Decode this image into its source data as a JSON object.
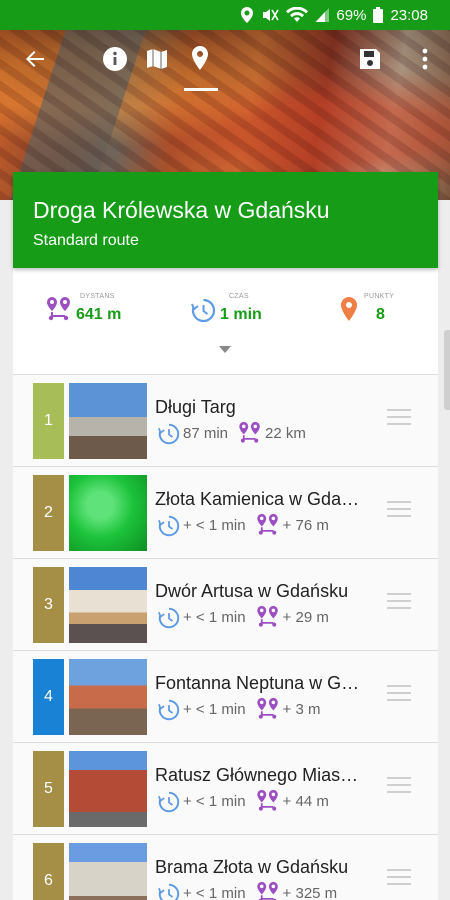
{
  "status_bar": {
    "battery": "69%",
    "time": "23:08"
  },
  "route": {
    "title": "Droga Królewska w Gdańsku",
    "subtitle": "Standard route"
  },
  "stats": {
    "distance": {
      "label": "DYSTANS",
      "value": "641 m"
    },
    "time": {
      "label": "CZAS",
      "value": "1 min"
    },
    "points": {
      "label": "PUNKTY",
      "value": "8"
    }
  },
  "colors": {
    "brand_green": "#169c17",
    "olive": "#a58f47",
    "lime": "#a7be58",
    "blue": "#1a82d5",
    "time_icon": "#5d9ae6",
    "distance_icon": "#9b4fc3",
    "pin_icon": "#f07f45"
  },
  "stops": [
    {
      "number": "1",
      "name": "Długi Targ",
      "time": "87 min",
      "distance": "22 km",
      "color": "#a7be58"
    },
    {
      "number": "2",
      "name": "Złota Kamienica w Gda…",
      "time": "+ < 1 min",
      "distance": "+ 76 m",
      "color": "#a58f47"
    },
    {
      "number": "3",
      "name": "Dwór Artusa w Gdańsku",
      "time": "+ < 1 min",
      "distance": "+ 29 m",
      "color": "#a58f47"
    },
    {
      "number": "4",
      "name": "Fontanna Neptuna w G…",
      "time": "+ < 1 min",
      "distance": "+ 3 m",
      "color": "#1a82d5"
    },
    {
      "number": "5",
      "name": "Ratusz Głównego Mias…",
      "time": "+ < 1 min",
      "distance": "+ 44 m",
      "color": "#a58f47"
    },
    {
      "number": "6",
      "name": "Brama Złota w Gdańsku",
      "time": "+ < 1 min",
      "distance": "+ 325 m",
      "color": "#a58f47"
    }
  ]
}
